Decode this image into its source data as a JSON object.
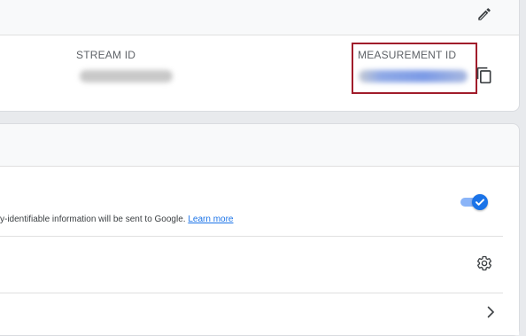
{
  "stream_details": {
    "stream_id_label": "STREAM ID",
    "measurement_id_label": "MEASUREMENT ID",
    "edit_icon": "pencil-icon",
    "copy_icon": "copy-icon"
  },
  "enhanced_measurement": {
    "info_text": "y-identifiable information will be sent to Google. ",
    "learn_more": "Learn more",
    "toggle_on": true,
    "accent_color": "#1a73e8",
    "settings_icon": "gear-icon",
    "chevron_icon": "chevron-right-icon"
  },
  "colors": {
    "highlight_border": "#a11d2b",
    "link": "#1a73e8"
  }
}
